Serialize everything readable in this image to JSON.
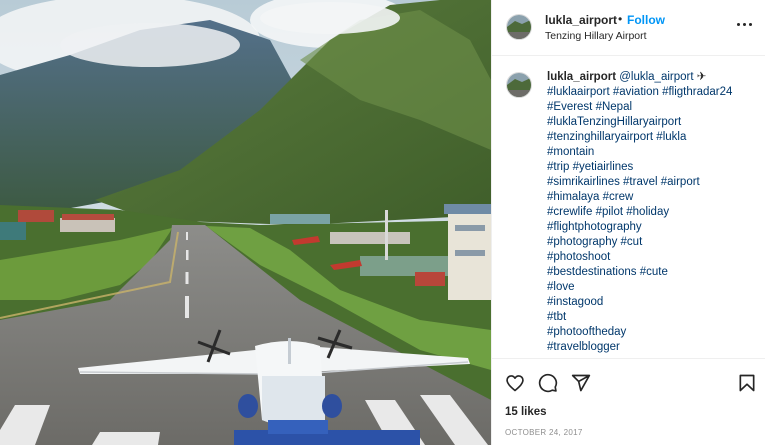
{
  "post": {
    "username": "lukla_airport",
    "separator": "•",
    "follow_label": "Follow",
    "location": "Tenzing Hillary Airport",
    "more_icon": "more-horizontal-icon",
    "photo_subject": "Lukla airport runway with aircraft and Himalayan mountains"
  },
  "caption": {
    "username": "lukla_airport",
    "handle": "@lukla_airport",
    "emoji": "✈",
    "hashtag_lines": [
      "#luklaairport #aviation #fligthradar24",
      "#Everest #Nepal",
      "#luklaTenzingHillaryairport",
      "#tenzinghillaryairport #lukla",
      "#montain",
      "#trip #yetiairlines",
      "#simrikairlines #travel #airport",
      "#himalaya #crew",
      "#crewlife #pilot #holiday",
      "#flightphotography",
      "#photography #cut",
      "#photoshoot",
      "#bestdestinations #cute",
      "#love",
      "#instagood",
      "#tbt",
      "#photooftheday",
      "#travelblogger"
    ]
  },
  "actions": {
    "like_icon": "heart-icon",
    "comment_icon": "comment-icon",
    "share_icon": "share-icon",
    "save_icon": "bookmark-icon",
    "likes_text": "15 likes",
    "date_text": "OCTOBER 24, 2017"
  },
  "colors": {
    "link": "#00376b",
    "follow": "#0095f6",
    "text": "#262626",
    "muted": "#8e8e8e",
    "divider": "#efefef"
  }
}
